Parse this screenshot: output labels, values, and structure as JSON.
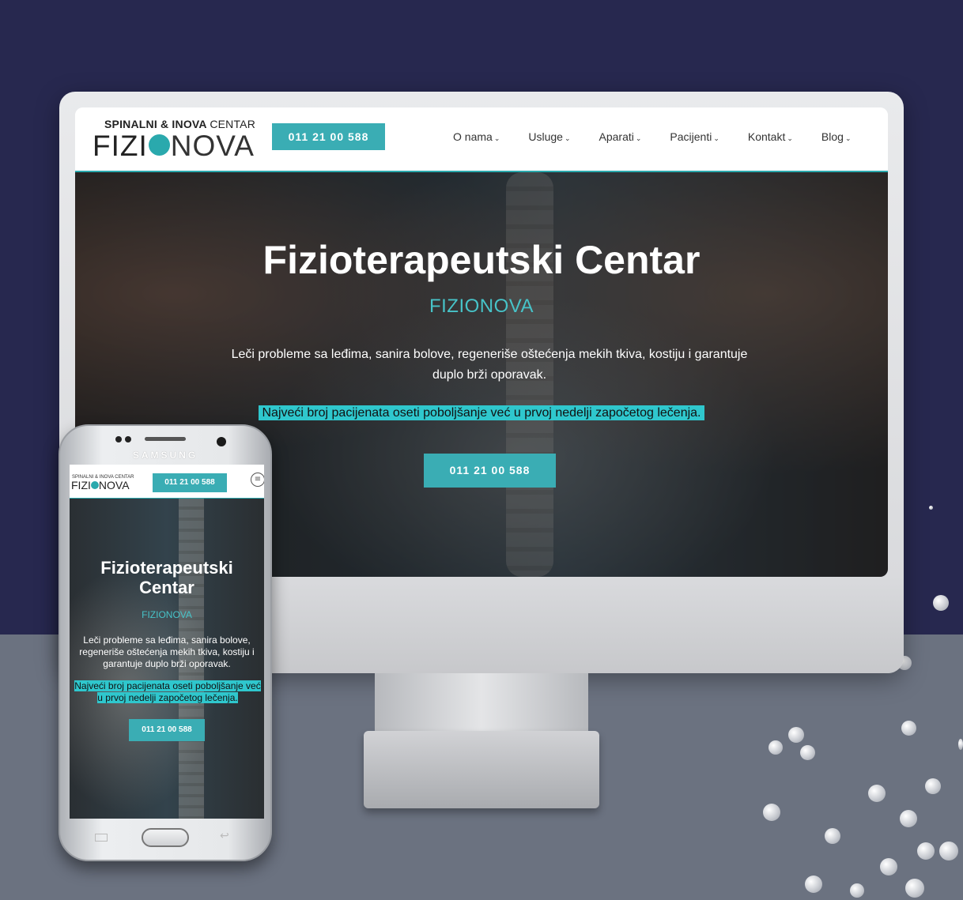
{
  "site": {
    "logo_top_bold": "SPINALNI & INOVA",
    "logo_top_light": "CENTAR",
    "logo_main_left": "FIZI",
    "logo_main_right": "NOVA",
    "phone": "011 21 00 588",
    "nav": [
      "O nama",
      "Usluge",
      "Aparati",
      "Pacijenti",
      "Kontakt",
      "Blog"
    ],
    "hero": {
      "title": "Fizioterapeutski Centar",
      "subtitle": "FIZIONOVA",
      "description": "Leči probleme sa leđima, sanira bolove, regeneriše oštećenja mekih tkiva, kostiju i garantuje duplo brži oporavak.",
      "highlight": "Najveći broj pacijenata oseti poboljšanje već u prvoj nedelji započetog lečenja.",
      "cta": "011 21 00 588"
    }
  },
  "mobile": {
    "brand": "SAMSUNG",
    "title": "Fizioterapeutski Centar",
    "subtitle": "FIZIONOVA",
    "description": "Leči probleme sa leđima, sanira bolove, regeneriše oštećenja mekih tkiva, kostiju i garantuje duplo brži oporavak.",
    "highlight": "Najveći broj pacijenata oseti poboljšanje već u prvoj nedelji započetog lečenja.",
    "phone": "011 21 00 588",
    "cta": "011 21 00 588",
    "logo_top": "SPINALNI & INOVA CENTAR",
    "logo_main_left": "FIZI",
    "logo_main_right": "NOVA"
  },
  "colors": {
    "background": "#27284f",
    "floor": "#6b7280",
    "accent": "#3aadb4",
    "highlight": "#2fc7cd"
  }
}
